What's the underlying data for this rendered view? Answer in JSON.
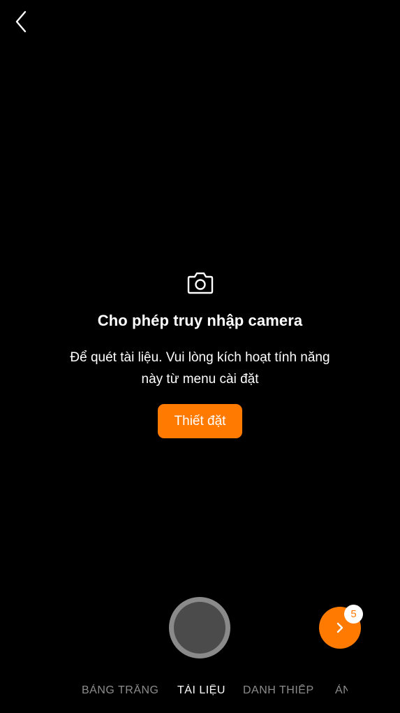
{
  "nav": {
    "back_icon": "chevron-left-icon"
  },
  "permission": {
    "icon": "camera-icon",
    "title": "Cho phép truy nhập camera",
    "description_line1": "Để quét tài liệu. Vui lòng kích hoạt tính năng",
    "description_line2": "này từ menu cài đặt",
    "settings_label": "Thiết đặt"
  },
  "capture": {
    "shutter_icon": "shutter-button",
    "next_icon": "chevron-right-icon",
    "page_count": "5"
  },
  "modes": [
    {
      "label": "BẢNG TRẮNG",
      "active": false
    },
    {
      "label": "TÀI LIỆU",
      "active": true
    },
    {
      "label": "DANH THIẾP",
      "active": false
    },
    {
      "label": "ẢNH",
      "active": false
    }
  ],
  "colors": {
    "accent": "#ff7a00",
    "background": "#000000",
    "inactive_tab": "#8c8c8c"
  }
}
